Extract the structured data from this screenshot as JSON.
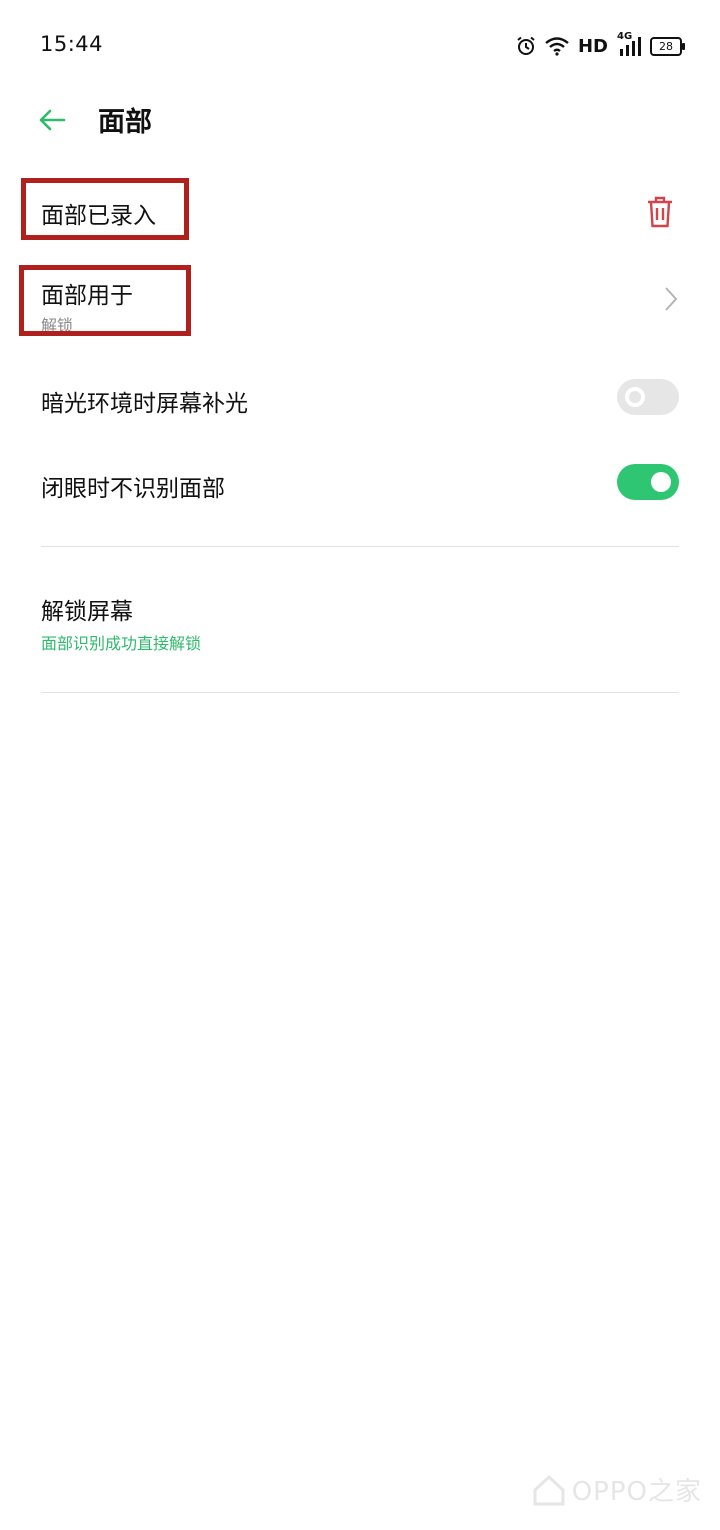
{
  "status_bar": {
    "time": "15:44",
    "hd": "HD",
    "network": "4G",
    "battery": "28",
    "icons": [
      "alarm-icon",
      "wifi-icon",
      "signal-icon",
      "battery-icon"
    ]
  },
  "header": {
    "title": "面部",
    "back_icon": "arrow-left-icon",
    "accent_color": "#2fba6c"
  },
  "rows": {
    "face_enrolled": {
      "title": "面部已录入",
      "action_icon": "trash-icon",
      "icon_color": "#d1454a"
    },
    "face_used_for": {
      "title": "面部用于",
      "subtitle": "解锁",
      "action_icon": "chevron-right-icon"
    },
    "screen_fill_light": {
      "title": "暗光环境时屏幕补光",
      "toggle": false
    },
    "eyes_closed": {
      "title": "闭眼时不识别面部",
      "toggle": true
    },
    "unlock_screen": {
      "title": "解锁屏幕",
      "subtitle": "面部识别成功直接解锁"
    }
  },
  "annotation": {
    "box_color": "#b0201d"
  },
  "watermark": {
    "text": "OPPO之家"
  }
}
